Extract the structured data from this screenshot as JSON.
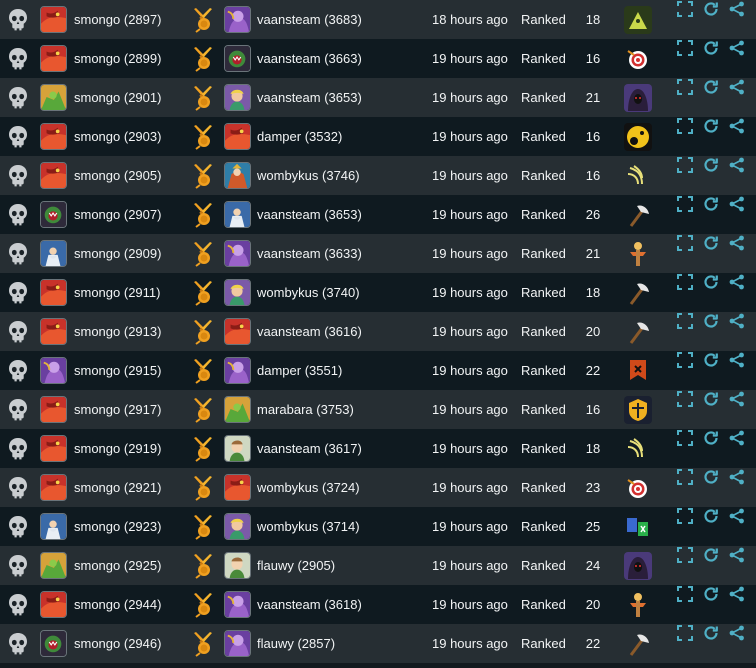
{
  "colors": {
    "row_odd": "#262e33",
    "row_even": "#0f1a20",
    "action": "#4fb0c6",
    "skull": "#c9cdd0",
    "vs": "#f0a020"
  },
  "rows": [
    {
      "result_icon": "skull-icon",
      "p1_avatar": "red-dragon",
      "p1": "smongo (2897)",
      "vs_icon": "swords-icon",
      "p2_avatar": "purple-troll",
      "p2": "vaansteam (3683)",
      "time": "18 hours ago",
      "type": "Ranked",
      "turns": "18",
      "map_icon": "mountain-map-icon"
    },
    {
      "result_icon": "skull-icon",
      "p1_avatar": "red-dragon",
      "p1": "smongo (2899)",
      "vs_icon": "swords-icon",
      "p2_avatar": "green-monster",
      "p2": "vaansteam (3663)",
      "time": "19 hours ago",
      "type": "Ranked",
      "turns": "16",
      "map_icon": "target-map-icon"
    },
    {
      "result_icon": "skull-icon",
      "p1_avatar": "green-goblin",
      "p1": "smongo (2901)",
      "vs_icon": "swords-icon",
      "p2_avatar": "blonde-hero",
      "p2": "vaansteam (3653)",
      "time": "19 hours ago",
      "type": "Ranked",
      "turns": "21",
      "map_icon": "hooded-map-icon"
    },
    {
      "result_icon": "skull-icon",
      "p1_avatar": "red-dragon",
      "p1": "smongo (2903)",
      "vs_icon": "swords-icon",
      "p2_avatar": "red-dragon",
      "p2": "damper (3532)",
      "time": "19 hours ago",
      "type": "Ranked",
      "turns": "16",
      "map_icon": "moon-map-icon"
    },
    {
      "result_icon": "skull-icon",
      "p1_avatar": "red-dragon",
      "p1": "smongo (2905)",
      "vs_icon": "swords-icon",
      "p2_avatar": "blue-mage",
      "p2": "wombykus (3746)",
      "time": "19 hours ago",
      "type": "Ranked",
      "turns": "16",
      "map_icon": "claw-map-icon"
    },
    {
      "result_icon": "skull-icon",
      "p1_avatar": "green-monster",
      "p1": "smongo (2907)",
      "vs_icon": "swords-icon",
      "p2_avatar": "blue-wizard",
      "p2": "vaansteam (3653)",
      "time": "19 hours ago",
      "type": "Ranked",
      "turns": "26",
      "map_icon": "axe-map-icon"
    },
    {
      "result_icon": "skull-icon",
      "p1_avatar": "blue-wizard",
      "p1": "smongo (2909)",
      "vs_icon": "swords-icon",
      "p2_avatar": "purple-troll",
      "p2": "vaansteam (3633)",
      "time": "19 hours ago",
      "type": "Ranked",
      "turns": "21",
      "map_icon": "dummy-map-icon"
    },
    {
      "result_icon": "skull-icon",
      "p1_avatar": "red-dragon",
      "p1": "smongo (2911)",
      "vs_icon": "swords-icon",
      "p2_avatar": "blonde-hero",
      "p2": "wombykus (3740)",
      "time": "19 hours ago",
      "type": "Ranked",
      "turns": "18",
      "map_icon": "axe-map-icon"
    },
    {
      "result_icon": "skull-icon",
      "p1_avatar": "red-dragon",
      "p1": "smongo (2913)",
      "vs_icon": "swords-icon",
      "p2_avatar": "red-dragon",
      "p2": "vaansteam (3616)",
      "time": "19 hours ago",
      "type": "Ranked",
      "turns": "20",
      "map_icon": "axe-map-icon"
    },
    {
      "result_icon": "skull-icon",
      "p1_avatar": "purple-troll",
      "p1": "smongo (2915)",
      "vs_icon": "swords-icon",
      "p2_avatar": "purple-troll",
      "p2": "damper (3551)",
      "time": "19 hours ago",
      "type": "Ranked",
      "turns": "22",
      "map_icon": "banner-map-icon"
    },
    {
      "result_icon": "skull-icon",
      "p1_avatar": "red-dragon",
      "p1": "smongo (2917)",
      "vs_icon": "swords-icon",
      "p2_avatar": "green-goblin",
      "p2": "marabara (3753)",
      "time": "19 hours ago",
      "type": "Ranked",
      "turns": "16",
      "map_icon": "shield-map-icon"
    },
    {
      "result_icon": "skull-icon",
      "p1_avatar": "red-dragon",
      "p1": "smongo (2919)",
      "vs_icon": "swords-icon",
      "p2_avatar": "elf-hero",
      "p2": "vaansteam (3617)",
      "time": "19 hours ago",
      "type": "Ranked",
      "turns": "18",
      "map_icon": "claw-map-icon"
    },
    {
      "result_icon": "skull-icon",
      "p1_avatar": "red-dragon",
      "p1": "smongo (2921)",
      "vs_icon": "swords-icon",
      "p2_avatar": "red-dragon",
      "p2": "wombykus (3724)",
      "time": "19 hours ago",
      "type": "Ranked",
      "turns": "23",
      "map_icon": "target-map-icon"
    },
    {
      "result_icon": "skull-icon",
      "p1_avatar": "blue-wizard",
      "p1": "smongo (2923)",
      "vs_icon": "swords-icon",
      "p2_avatar": "blonde-hero",
      "p2": "wombykus (3714)",
      "time": "19 hours ago",
      "type": "Ranked",
      "turns": "25",
      "map_icon": "cards-map-icon"
    },
    {
      "result_icon": "skull-icon",
      "p1_avatar": "green-goblin",
      "p1": "smongo (2925)",
      "vs_icon": "swords-icon",
      "p2_avatar": "elf-hero",
      "p2": "flauwy (2905)",
      "time": "19 hours ago",
      "type": "Ranked",
      "turns": "24",
      "map_icon": "hooded-map-icon"
    },
    {
      "result_icon": "skull-icon",
      "p1_avatar": "red-dragon",
      "p1": "smongo (2944)",
      "vs_icon": "swords-icon",
      "p2_avatar": "purple-troll",
      "p2": "vaansteam (3618)",
      "time": "19 hours ago",
      "type": "Ranked",
      "turns": "20",
      "map_icon": "dummy-map-icon"
    },
    {
      "result_icon": "skull-icon",
      "p1_avatar": "green-monster",
      "p1": "smongo (2946)",
      "vs_icon": "swords-icon",
      "p2_avatar": "purple-troll",
      "p2": "flauwy (2857)",
      "time": "19 hours ago",
      "type": "Ranked",
      "turns": "22",
      "map_icon": "axe-map-icon"
    }
  ]
}
